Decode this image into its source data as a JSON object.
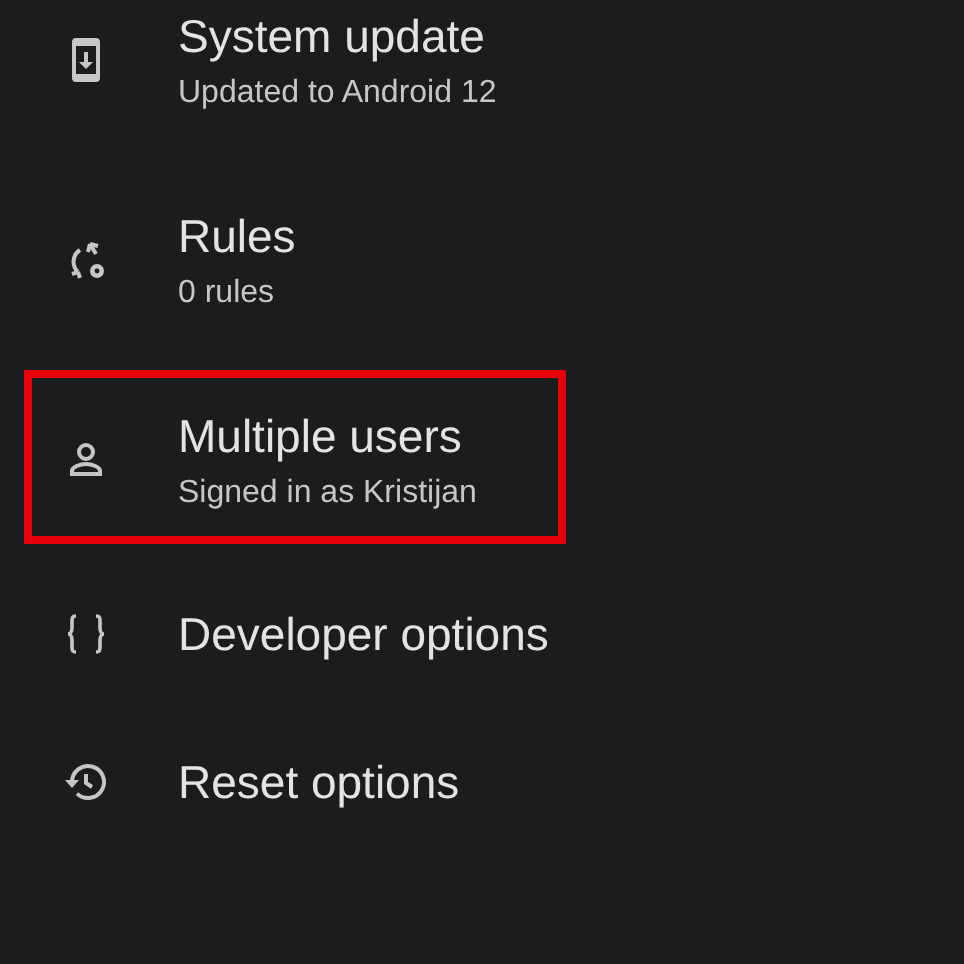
{
  "items": [
    {
      "kind": "phone-download",
      "title": "System update",
      "subtitle": "Updated to Android 12",
      "highlighted": false
    },
    {
      "kind": "rules",
      "title": "Rules",
      "subtitle": "0 rules",
      "highlighted": false
    },
    {
      "kind": "person",
      "title": "Multiple users",
      "subtitle": "Signed in as Kristijan",
      "highlighted": true
    },
    {
      "kind": "braces",
      "title": "Developer options",
      "highlighted": false
    },
    {
      "kind": "history",
      "title": "Reset options",
      "highlighted": false
    }
  ]
}
